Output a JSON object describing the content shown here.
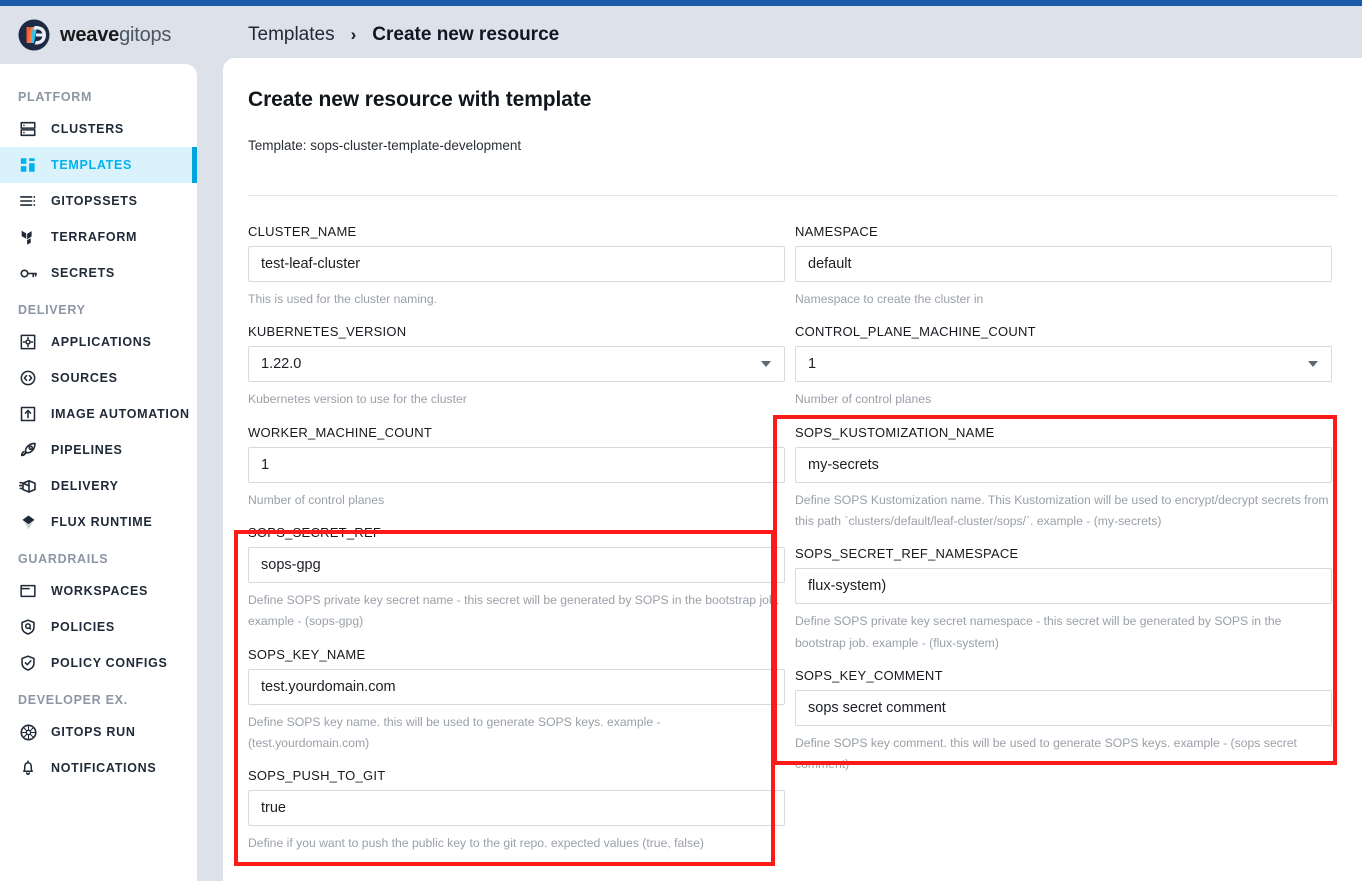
{
  "theme": {
    "accent_blue": "#00b3ec",
    "top_bar": "#1a5aa8",
    "header_bg": "#dde1e9",
    "annotation_red": "#ff1a1a",
    "active_item_bg": "#daf2fc"
  },
  "header": {
    "brand_bold": "weave",
    "brand_light": "gitops",
    "logo_icon": "weave-gitops-logo-icon",
    "breadcrumb": {
      "parent": "Templates",
      "separator": "›",
      "current": "Create new resource"
    }
  },
  "sidebar": {
    "sections": [
      {
        "label": "PLATFORM",
        "items": [
          {
            "label": "CLUSTERS",
            "icon": "clusters-icon",
            "active": false
          },
          {
            "label": "TEMPLATES",
            "icon": "templates-icon",
            "active": true
          },
          {
            "label": "GITOPSSETS",
            "icon": "gitopssets-icon",
            "active": false
          },
          {
            "label": "TERRAFORM",
            "icon": "terraform-icon",
            "active": false
          },
          {
            "label": "SECRETS",
            "icon": "key-icon",
            "active": false
          }
        ]
      },
      {
        "label": "DELIVERY",
        "items": [
          {
            "label": "APPLICATIONS",
            "icon": "applications-icon",
            "active": false
          },
          {
            "label": "SOURCES",
            "icon": "sources-icon",
            "active": false
          },
          {
            "label": "IMAGE AUTOMATION",
            "icon": "image-automation-icon",
            "active": false
          },
          {
            "label": "PIPELINES",
            "icon": "rocket-icon",
            "active": false
          },
          {
            "label": "DELIVERY",
            "icon": "package-icon",
            "active": false
          },
          {
            "label": "FLUX RUNTIME",
            "icon": "flux-icon",
            "active": false
          }
        ]
      },
      {
        "label": "GUARDRAILS",
        "items": [
          {
            "label": "WORKSPACES",
            "icon": "workspaces-icon",
            "active": false
          },
          {
            "label": "POLICIES",
            "icon": "policies-shield-icon",
            "active": false
          },
          {
            "label": "POLICY CONFIGS",
            "icon": "shield-check-icon",
            "active": false
          }
        ]
      },
      {
        "label": "DEVELOPER EX.",
        "items": [
          {
            "label": "GITOPS RUN",
            "icon": "gitops-run-icon",
            "active": false
          },
          {
            "label": "NOTIFICATIONS",
            "icon": "bell-icon",
            "active": false
          }
        ]
      }
    ]
  },
  "main": {
    "title": "Create new resource with template",
    "template_line": "Template: sops-cluster-template-development",
    "fields_left": [
      {
        "label": "CLUSTER_NAME",
        "value": "test-leaf-cluster",
        "help": "This is used for the cluster naming.",
        "type": "text"
      },
      {
        "label": "KUBERNETES_VERSION",
        "value": "1.22.0",
        "help": "Kubernetes version to use for the cluster",
        "type": "select"
      },
      {
        "label": "WORKER_MACHINE_COUNT",
        "value": "1",
        "help": "Number of control planes",
        "type": "text"
      },
      {
        "label": "SOPS_SECRET_REF",
        "value": "sops-gpg",
        "help": "Define SOPS private key secret name - this secret will be generated by SOPS in the bootstrap job. example - (sops-gpg)",
        "type": "text"
      },
      {
        "label": "SOPS_KEY_NAME",
        "value": "test.yourdomain.com",
        "help": "Define SOPS key name. this will be used to generate SOPS keys. example - (test.yourdomain.com)",
        "type": "text"
      },
      {
        "label": "SOPS_PUSH_TO_GIT",
        "value": "true",
        "help": "Define if you want to push the public key to the git repo. expected values (true, false)",
        "type": "text"
      }
    ],
    "fields_right": [
      {
        "label": "NAMESPACE",
        "value": "default",
        "help": "Namespace to create the cluster in",
        "type": "text"
      },
      {
        "label": "CONTROL_PLANE_MACHINE_COUNT",
        "value": "1",
        "help": "Number of control planes",
        "type": "select"
      },
      {
        "label": "SOPS_KUSTOMIZATION_NAME",
        "value": "my-secrets",
        "help": "Define SOPS Kustomization name. This Kustomization will be used to encrypt/decrypt secrets from this path `clusters/default/leaf-cluster/sops/`. example - (my-secrets)",
        "type": "text"
      },
      {
        "label": "SOPS_SECRET_REF_NAMESPACE",
        "value": "flux-system)",
        "help": "Define SOPS private key secret namespace - this secret will be generated by SOPS in the bootstrap job. example - (flux-system)",
        "type": "text"
      },
      {
        "label": "SOPS_KEY_COMMENT",
        "value": "sops secret comment",
        "help": "Define SOPS key comment. this will be used to generate SOPS keys. example - (sops secret comment)",
        "type": "text"
      }
    ]
  }
}
